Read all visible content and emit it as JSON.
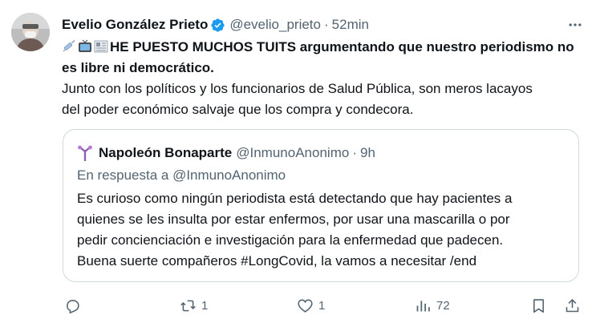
{
  "tweet": {
    "author": "Evelio González Prieto",
    "handle": "@evelio_prieto",
    "separator": "·",
    "time": "52min",
    "bold_text": "HE PUESTO MUCHOS TUITS argumentando que nuestro periodismo no es libre ni democrático.",
    "text_line1": "Junto con los políticos y los funcionarios de Salud Pública, son meros lacayos",
    "text_line2": "del poder económico salvaje que los compra y condecora.",
    "emoji_icons": [
      "syringe-icon",
      "tv-icon",
      "newspaper-icon"
    ]
  },
  "quote": {
    "author": "Napoleón Bonaparte",
    "handle": "@InmunoAnonimo",
    "separator": "·",
    "time": "9h",
    "reply_to": "En respuesta a @InmunoAnonimo",
    "lines": [
      "Es curioso como ningún periodista está detectando que hay pacientes a",
      "quienes se les insulta por estar enfermos, por usar una mascarilla o por",
      "pedir concienciación e investigación para la enfermedad que padecen.",
      "Buena suerte compañeros #LongCovid, la vamos a necesitar /end"
    ]
  },
  "actions": {
    "reply_count": "",
    "retweet_count": "1",
    "like_count": "1",
    "views_count": "72"
  },
  "colors": {
    "text": "#0f1419",
    "muted": "#536471",
    "verified": "#1d9bf0",
    "border": "#cfd9de"
  }
}
